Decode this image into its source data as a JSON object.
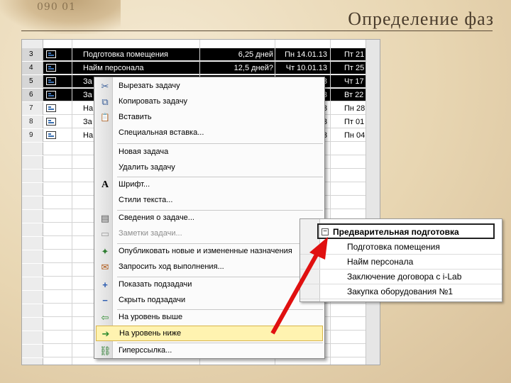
{
  "slide": {
    "title": "Определение фаз",
    "decor_text": "090  01"
  },
  "task_table": {
    "rows": [
      {
        "num": "3",
        "name": "Подготовка помещения",
        "duration": "6,25 дней",
        "start": "Пн 14.01.13",
        "finish": "Пт 21",
        "selected": true
      },
      {
        "num": "4",
        "name": "Найм персонала",
        "duration": "12,5 дней?",
        "start": "Чт 10.01.13",
        "finish": "Пт 25",
        "selected": true
      },
      {
        "num": "5",
        "name": "За",
        "duration": "",
        "start": "3",
        "finish": "Чт 17",
        "selected": true
      },
      {
        "num": "6",
        "name": "За",
        "duration": "",
        "start": "3",
        "finish": "Вт 22",
        "selected": true
      },
      {
        "num": "7",
        "name": "На",
        "duration": "",
        "start": "3",
        "finish": "Пн 28",
        "selected": false
      },
      {
        "num": "8",
        "name": "За",
        "duration": "",
        "start": "3",
        "finish": "Пт 01",
        "selected": false
      },
      {
        "num": "9",
        "name": "На",
        "duration": "",
        "start": "3",
        "finish": "Пн 04",
        "selected": false
      }
    ]
  },
  "context_menu": {
    "items": [
      {
        "label": "Вырезать задачу",
        "icon": "scissors-icon",
        "glyph": "✂"
      },
      {
        "label": "Копировать задачу",
        "icon": "copy-icon",
        "glyph": "⧉"
      },
      {
        "label": "Вставить",
        "icon": "paste-icon",
        "glyph": "📋"
      },
      {
        "label": "Специальная вставка...",
        "icon": "",
        "glyph": ""
      },
      {
        "label": "Новая задача",
        "icon": "",
        "glyph": ""
      },
      {
        "label": "Удалить задачу",
        "icon": "",
        "glyph": ""
      },
      {
        "label": "Шрифт...",
        "icon": "font-icon",
        "glyph": "A"
      },
      {
        "label": "Стили текста...",
        "icon": "",
        "glyph": ""
      },
      {
        "label": "Сведения о задаче...",
        "icon": "task-info-icon",
        "glyph": "▤"
      },
      {
        "label": "Заметки задачи...",
        "icon": "notes-icon",
        "glyph": "▭",
        "disabled": true
      },
      {
        "label": "Опубликовать новые и измененные назначения",
        "icon": "publish-icon",
        "glyph": "✦"
      },
      {
        "label": "Запросить ход выполнения...",
        "icon": "request-progress-icon",
        "glyph": "✉"
      },
      {
        "label": "Показать подзадачи",
        "icon": "plus-icon",
        "glyph": "+"
      },
      {
        "label": "Скрыть подзадачи",
        "icon": "minus-icon",
        "glyph": "−"
      },
      {
        "label": "На уровень выше",
        "icon": "outdent-arrow-icon",
        "glyph": "⇦"
      },
      {
        "label": "На уровень ниже",
        "icon": "indent-arrow-icon",
        "glyph": "➔",
        "highlighted": true
      },
      {
        "label": "Гиперссылка...",
        "icon": "hyperlink-icon",
        "glyph": "⛓"
      }
    ]
  },
  "inset": {
    "minus_glyph": "−",
    "header": "Предварительная подготовка",
    "children": [
      "Подготовка помещения",
      "Найм персонала",
      "Заключение договора с i-Lab",
      "Закупка оборудования №1"
    ]
  },
  "colors": {
    "arrow": "#e01010",
    "highlight": "#fff3b0",
    "selection": "#000000"
  }
}
